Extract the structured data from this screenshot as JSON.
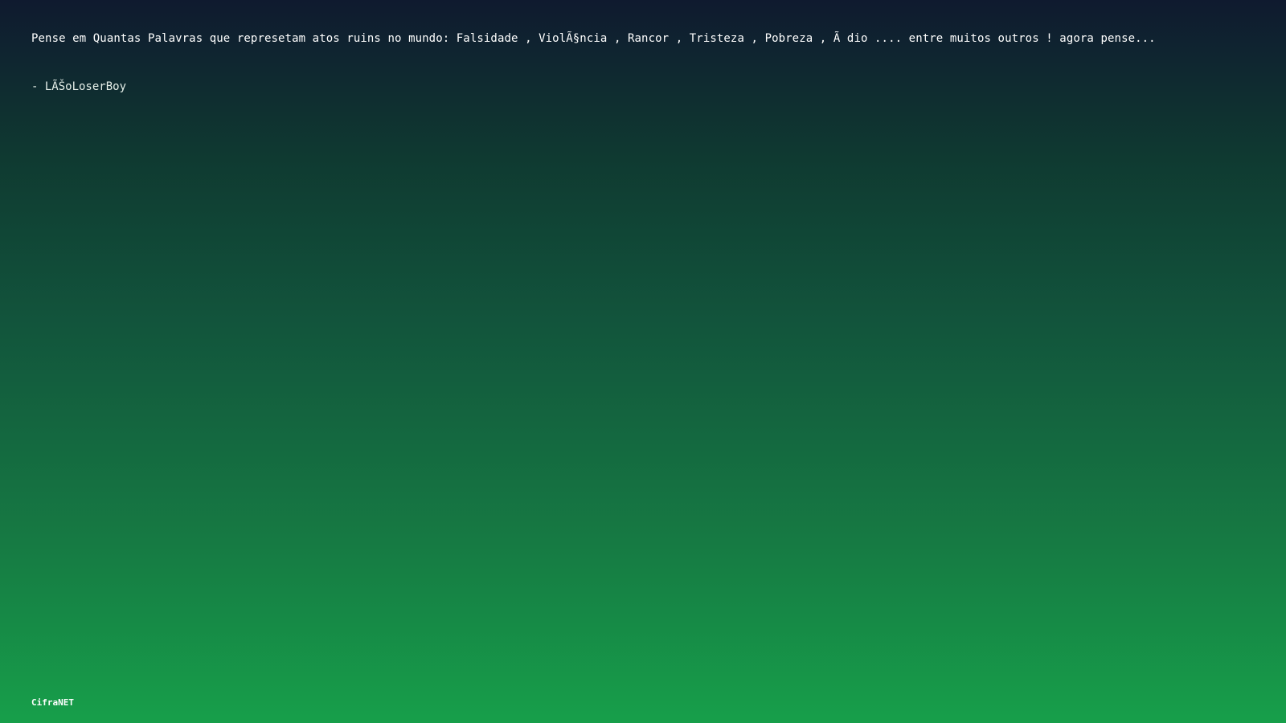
{
  "quote": {
    "text": "Pense em Quantas Palavras que represetam atos ruins no mundo: Falsidade , ViolÃ§ncia , Rancor , Tristeza , Pobreza , Ã dio .... entre muitos outros ! agora pense...",
    "author": "- LÃŠoLoserBoy"
  },
  "footer": {
    "brand": "CifraNET"
  }
}
